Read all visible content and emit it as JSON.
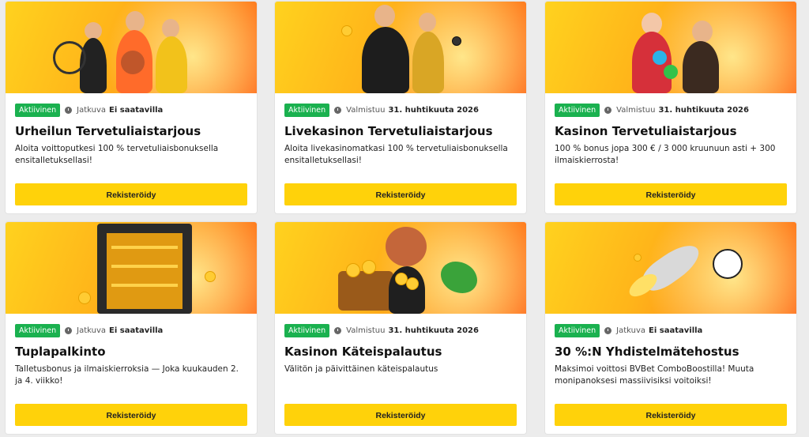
{
  "cards": [
    {
      "badge": "Aktiivinen",
      "status": "Jatkuva",
      "value": "Ei saatavilla",
      "title": "Urheilun Tervetuliaistarjous",
      "desc": "Aloita voittoputkesi 100 % tervetuliaisbonuksella ensitalletuksellasi!",
      "cta": "Rekisteröidy"
    },
    {
      "badge": "Aktiivinen",
      "status": "Valmistuu",
      "value": "31. huhtikuuta 2026",
      "title": "Livekasinon Tervetuliaistarjous",
      "desc": "Aloita livekasinomatkasi 100 % tervetuliaisbonuksella ensitalletuksellasi!",
      "cta": "Rekisteröidy"
    },
    {
      "badge": "Aktiivinen",
      "status": "Valmistuu",
      "value": "31. huhtikuuta 2026",
      "title": "Kasinon Tervetuliaistarjous",
      "desc": "100 % bonus jopa 300 € / 3 000 kruunuun asti + 300 ilmaiskierrosta!",
      "cta": "Rekisteröidy"
    },
    {
      "badge": "Aktiivinen",
      "status": "Jatkuva",
      "value": "Ei saatavilla",
      "title": "Tuplapalkinto",
      "desc": "Talletusbonus ja ilmaiskierroksia — Joka kuukauden 2. ja 4. viikko!",
      "cta": "Rekisteröidy"
    },
    {
      "badge": "Aktiivinen",
      "status": "Valmistuu",
      "value": "31. huhtikuuta 2026",
      "title": "Kasinon Käteispalautus",
      "desc": "Välitön ja päivittäinen käteispalautus",
      "cta": "Rekisteröidy"
    },
    {
      "badge": "Aktiivinen",
      "status": "Jatkuva",
      "value": "Ei saatavilla",
      "title": "30 %:N Yhdistelmätehostus",
      "desc": "Maksimoi voittosi BVBet ComboBoostilla! Muuta monipanoksesi massiivisiksi voitoiksi!",
      "cta": "Rekisteröidy"
    }
  ],
  "colors": {
    "badge": "#1ab14f",
    "button": "#ffd20a",
    "banner_start": "#ffd21e",
    "banner_end": "#ff6a1a"
  },
  "icons": [
    "clock-icon"
  ]
}
